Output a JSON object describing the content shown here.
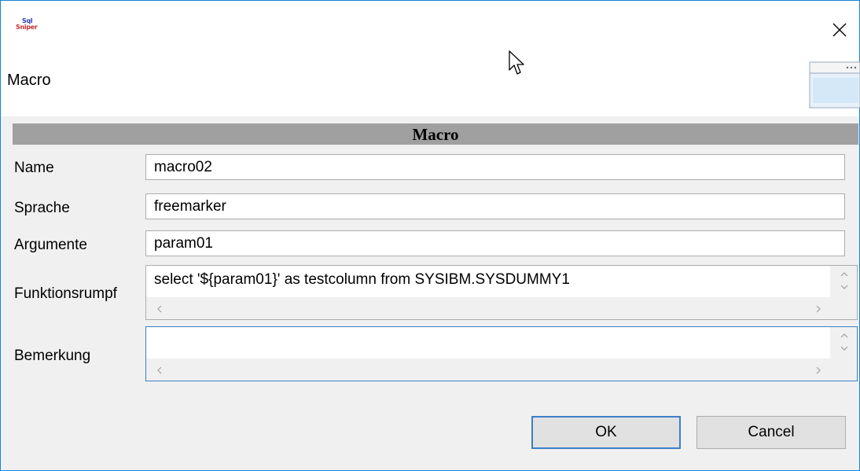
{
  "window": {
    "app_icon_text": [
      "Sql",
      "Sniper"
    ],
    "title": "Macro"
  },
  "form": {
    "header": "Macro",
    "name_label": "Name",
    "name_value": "macro02",
    "language_label": "Sprache",
    "language_value": "freemarker",
    "arguments_label": "Argumente",
    "arguments_value": "param01",
    "body_label": "Funktionsrumpf",
    "body_value": "select '${param01}' as testcolumn from SYSIBM.SYSDUMMY1",
    "remark_label": "Bemerkung",
    "remark_value": ""
  },
  "buttons": {
    "ok": "OK",
    "cancel": "Cancel"
  },
  "icons": {
    "close": "close-icon",
    "app": "app-icon",
    "scroll_up": "chevron-up-icon",
    "scroll_down": "chevron-down-icon",
    "scroll_left": "chevron-left-icon",
    "scroll_right": "chevron-right-icon"
  },
  "colors": {
    "window_border": "#1883d7",
    "header_bg": "#a0a0a0",
    "focus_border": "#3c7fc8"
  }
}
